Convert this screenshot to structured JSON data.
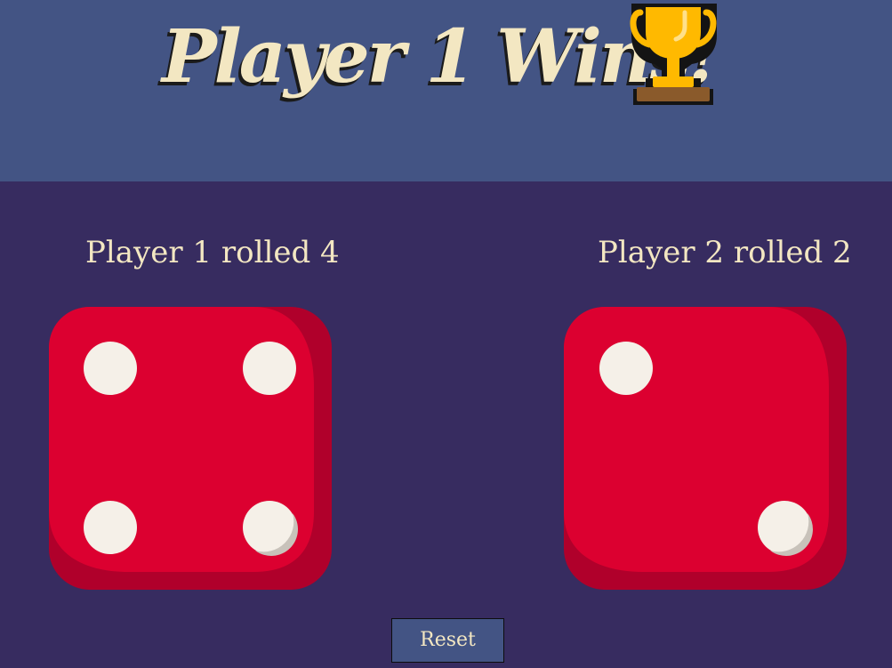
{
  "header": {
    "title": "Player 1 Wins!",
    "trophy_icon": "trophy-icon"
  },
  "players": [
    {
      "label": "Player 1 rolled 4",
      "roll": 4
    },
    {
      "label": "Player 2 rolled 2",
      "roll": 2
    }
  ],
  "controls": {
    "reset_label": "Reset"
  },
  "colors": {
    "header_bg": "#435484",
    "page_bg": "#372c60",
    "text": "#f3e7c2",
    "die_face": "#dc0030",
    "die_shadow": "#b0002b",
    "pip": "#f5f0e8",
    "trophy_gold": "#ffb900"
  }
}
